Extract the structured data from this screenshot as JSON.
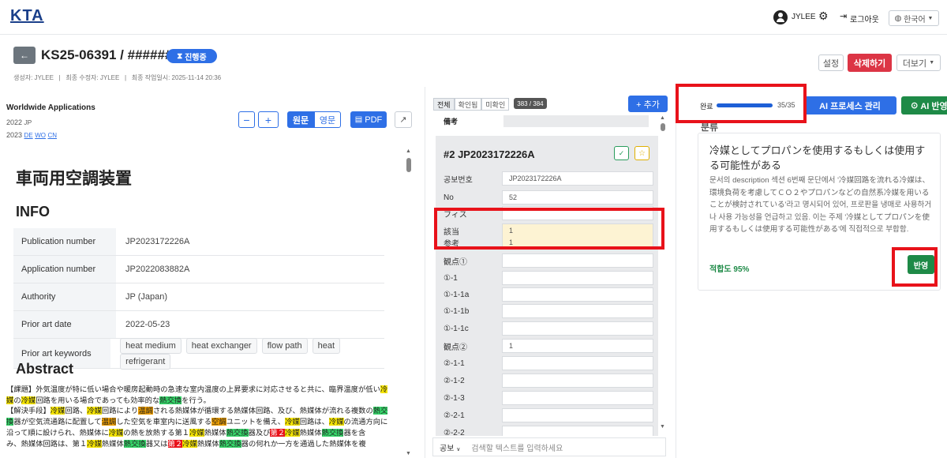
{
  "header": {
    "logo": "KTA",
    "user": "JYLEE",
    "logout": "로그아웃",
    "language": "한국어"
  },
  "page": {
    "title": "KS25-06391 / ######",
    "status": "진행중",
    "meta": "생성자: JYLEE   |   최종 수정자: JYLEE   |   최종 작업일시: 2025-11-14 20:36",
    "settings": "설정",
    "delete": "삭제하기",
    "more": "더보기"
  },
  "left": {
    "source": "Worldwide Applications",
    "year1": "2022",
    "fam1": "JP",
    "year2": "2023",
    "links": [
      "DE",
      "WO",
      "CN"
    ],
    "original": "원문",
    "english": "영문",
    "pdf": "PDF",
    "doc_title": "車両用空調装置",
    "info_heading": "INFO",
    "info": [
      {
        "k": "Publication number",
        "v": "JP2023172226A"
      },
      {
        "k": "Application number",
        "v": "JP2022083882A"
      },
      {
        "k": "Authority",
        "v": "JP (Japan)"
      },
      {
        "k": "Prior art date",
        "v": "2022-05-23"
      }
    ],
    "keywords_label": "Prior art keywords",
    "keywords": [
      "heat medium",
      "heat exchanger",
      "flow path",
      "heat",
      "refrigerant"
    ],
    "abstract_heading": "Abstract",
    "abs": [
      "【課題】外気温度が特に低い場合や暖房起動時の急速な室内温度の上昇要求に対応させると共に、臨界温度が低い",
      "冷",
      "媒",
      "の",
      "冷媒",
      "回路を用いる場合であっても効率的な",
      "熱交換",
      "を行う。",
      "【解決手段】",
      "冷媒",
      "回路、",
      "冷媒",
      "回路により",
      "温調",
      "される熱媒体が循環する熱媒体回路、及び、熱媒体が流れる複数の",
      "熱交",
      "換",
      "器が空気流通路に配置して",
      "温調",
      "した空気を車室内に送風する",
      "空調",
      "ユニットを備え、",
      "冷媒",
      "回路は、",
      "冷媒",
      "の流通方向に",
      "沿って順に設けられ、熱媒体に",
      "冷媒",
      "の熱を放熱する第１",
      "冷媒",
      "熱媒体",
      "熱交換",
      "器及び",
      "第２",
      "冷媒",
      "熱媒体",
      "熱交換",
      "器を含",
      "み、熱媒体回路は、第１",
      "冷媒",
      "熱媒体",
      "熱交換",
      "器又は",
      "第２",
      "冷媒",
      "熱媒体",
      "熱交換",
      "器の何れか一方を通過した熱媒体を複"
    ]
  },
  "mid": {
    "tabs": [
      "전체",
      "확인됨",
      "미확인"
    ],
    "count": "383 / 384",
    "add": "+ 추가",
    "memo_label": "備考",
    "entry_title": "#2 JP2023172226A",
    "fields": [
      {
        "k": "공보번호",
        "v": "JP2023172226A"
      },
      {
        "k": "No",
        "v": "52"
      },
      {
        "k": "フィス",
        "v": ""
      },
      {
        "k": "該当",
        "v": "1"
      },
      {
        "k": "参考",
        "v": "1"
      },
      {
        "k": "観点①",
        "v": ""
      },
      {
        "k": "①-1",
        "v": ""
      },
      {
        "k": "①-1-1a",
        "v": ""
      },
      {
        "k": "①-1-1b",
        "v": ""
      },
      {
        "k": "①-1-1c",
        "v": ""
      },
      {
        "k": "観点②",
        "v": "1"
      },
      {
        "k": "②-1-1",
        "v": ""
      },
      {
        "k": "②-1-2",
        "v": ""
      },
      {
        "k": "②-1-3",
        "v": ""
      },
      {
        "k": "②-2-1",
        "v": ""
      },
      {
        "k": "②-2-2",
        "v": ""
      }
    ],
    "search_scope": "공보",
    "search_placeholder": "검색할 텍스트를 입력하세요"
  },
  "right": {
    "progress_label": "완료",
    "progress_text": "35/35",
    "progress": 1.0,
    "ai_process": "AI 프로세스 관리",
    "ai_apply": "AI 반영 설정",
    "section": "분류",
    "card_title": "冷媒としてプロパンを使用するもしくは使用する可能性がある",
    "card_body": "문서의 description 섹션 6번째 문단에서 '冷媒回路を流れる冷媒は、環境負荷を考慮してＣＯ２やプロパンなどの自然系冷媒を用いることが検討されている'라고 명시되어 있어, 프로판을 냉매로 사용하거나 사용 가능성을 언급하고 있음. 이는 주제 '冷媒としてプロパンを使用するもしくは使用する可能性がある'에 직접적으로 부합함.",
    "score": "적합도 95%",
    "apply": "반영"
  },
  "colors": {
    "accent": "#2e6fe6",
    "danger": "#dc3545",
    "success": "#1e8a47",
    "highlight": "#e8121a"
  }
}
